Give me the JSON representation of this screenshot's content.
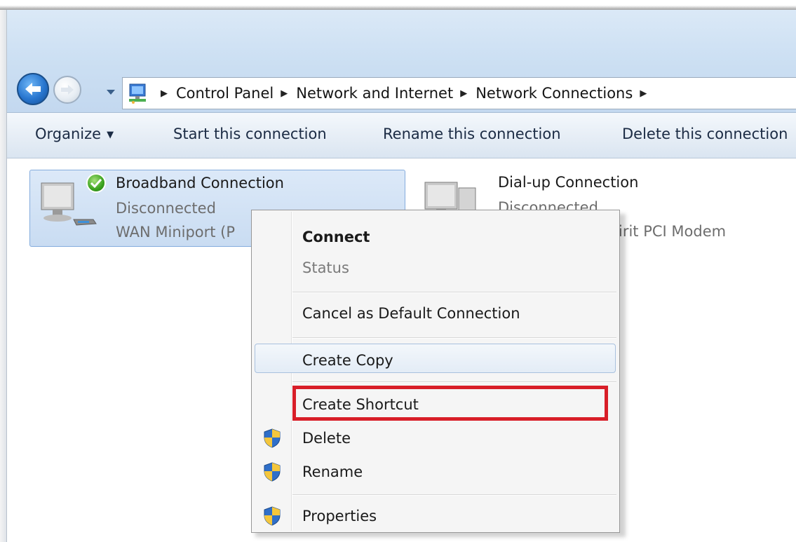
{
  "breadcrumb": {
    "items": [
      "Control Panel",
      "Network and Internet",
      "Network Connections"
    ]
  },
  "toolbar": {
    "organize": "Organize",
    "start": "Start this connection",
    "rename": "Rename this connection",
    "delete": "Delete this connection"
  },
  "connections": [
    {
      "name": "Broadband Connection",
      "status": "Disconnected",
      "device": "WAN Miniport (P",
      "connected_badge": "check-icon"
    },
    {
      "name": "Dial-up Connection",
      "status": "Disconnected",
      "device": "irit PCI Modem"
    }
  ],
  "context_menu": {
    "items": [
      {
        "label": "Connect",
        "default": true
      },
      {
        "label": "Status",
        "disabled": true
      },
      {
        "label": "Cancel as Default Connection"
      },
      {
        "label": "Create Copy",
        "hovered": true
      },
      {
        "label": "Create Shortcut",
        "highlighted": true
      },
      {
        "label": "Delete",
        "icon": "uac-shield-icon"
      },
      {
        "label": "Rename",
        "icon": "uac-shield-icon"
      },
      {
        "label": "Properties",
        "icon": "uac-shield-icon"
      }
    ]
  },
  "colors": {
    "highlight_border": "#d81e28",
    "selection": "#c9dcf2",
    "accent": "#2876cf"
  }
}
